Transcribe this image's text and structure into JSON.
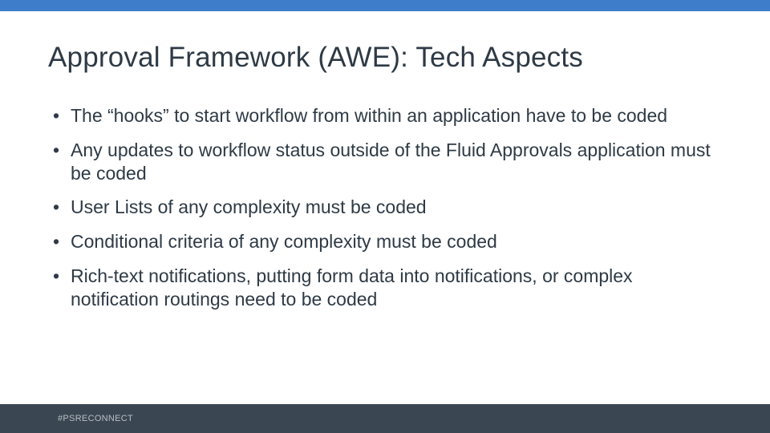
{
  "title": "Approval Framework (AWE): Tech Aspects",
  "bullets": [
    "The “hooks” to start workflow from within an application have to be coded",
    "Any updates to workflow status outside of the Fluid Approvals application must be coded",
    "User Lists of any complexity must be coded",
    "Conditional criteria of any complexity must be coded",
    "Rich-text notifications, putting form data into notifications, or complex notification routings need to be coded"
  ],
  "footer": "#PSRECONNECT"
}
